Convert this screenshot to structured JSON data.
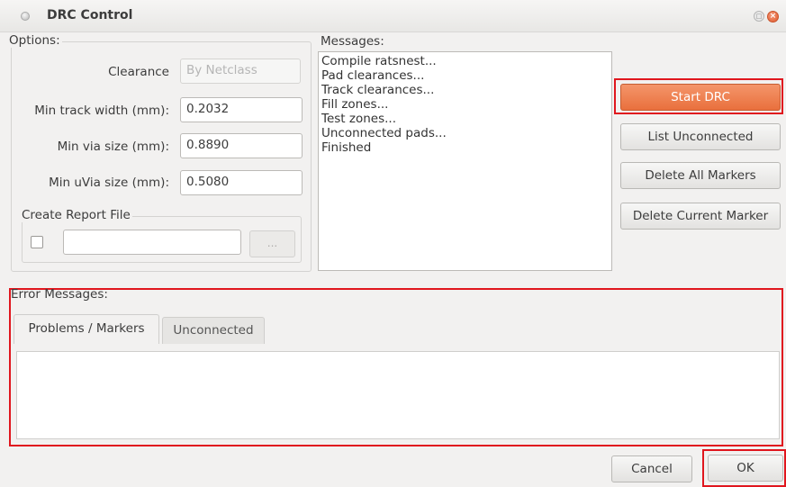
{
  "window": {
    "title": "DRC Control"
  },
  "options": {
    "label": "Options:",
    "clearance": {
      "label": "Clearance",
      "value": "By Netclass"
    },
    "min_track_width": {
      "label": "Min track width (mm):",
      "value": "0.2032"
    },
    "min_via_size": {
      "label": "Min via size (mm):",
      "value": "0.8890"
    },
    "min_uvia_size": {
      "label": "Min uVia size (mm):",
      "value": "0.5080"
    },
    "report": {
      "label": "Create Report File",
      "path_value": "",
      "browse_label": "..."
    }
  },
  "messages": {
    "label": "Messages:",
    "lines": [
      "Compile ratsnest...",
      "Pad clearances...",
      "Track clearances...",
      "Fill zones...",
      "Test zones...",
      "Unconnected pads...",
      "Finished"
    ]
  },
  "actions": {
    "start_drc": "Start DRC",
    "list_unconnected": "List Unconnected",
    "delete_all_markers": "Delete All Markers",
    "delete_current_marker": "Delete Current Marker"
  },
  "errors": {
    "label": "Error Messages:",
    "tabs": [
      "Problems / Markers",
      "Unconnected"
    ]
  },
  "footer": {
    "cancel": "Cancel",
    "ok": "OK"
  },
  "colors": {
    "accent": "#e9703d",
    "highlight": "#e0161e"
  }
}
